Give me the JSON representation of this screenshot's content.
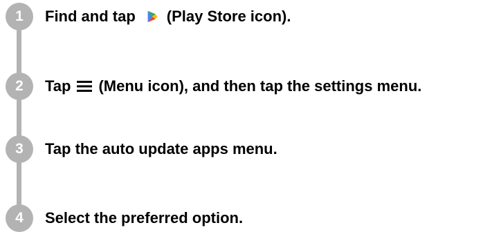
{
  "steps": [
    {
      "number": "1",
      "text_before": "Find and tap",
      "icon": "play-store-icon",
      "text_after": "(Play Store icon)."
    },
    {
      "number": "2",
      "text_before": "Tap",
      "icon": "menu-icon",
      "text_after": "(Menu icon), and then tap the settings menu."
    },
    {
      "number": "3",
      "text": "Tap the auto update apps menu."
    },
    {
      "number": "4",
      "text": "Select the preferred option."
    }
  ],
  "colors": {
    "step_circle": "#b3b3b3",
    "text": "#000000",
    "play_icon": [
      "#4285f4",
      "#34a853",
      "#fbbc04",
      "#ea4335"
    ]
  }
}
